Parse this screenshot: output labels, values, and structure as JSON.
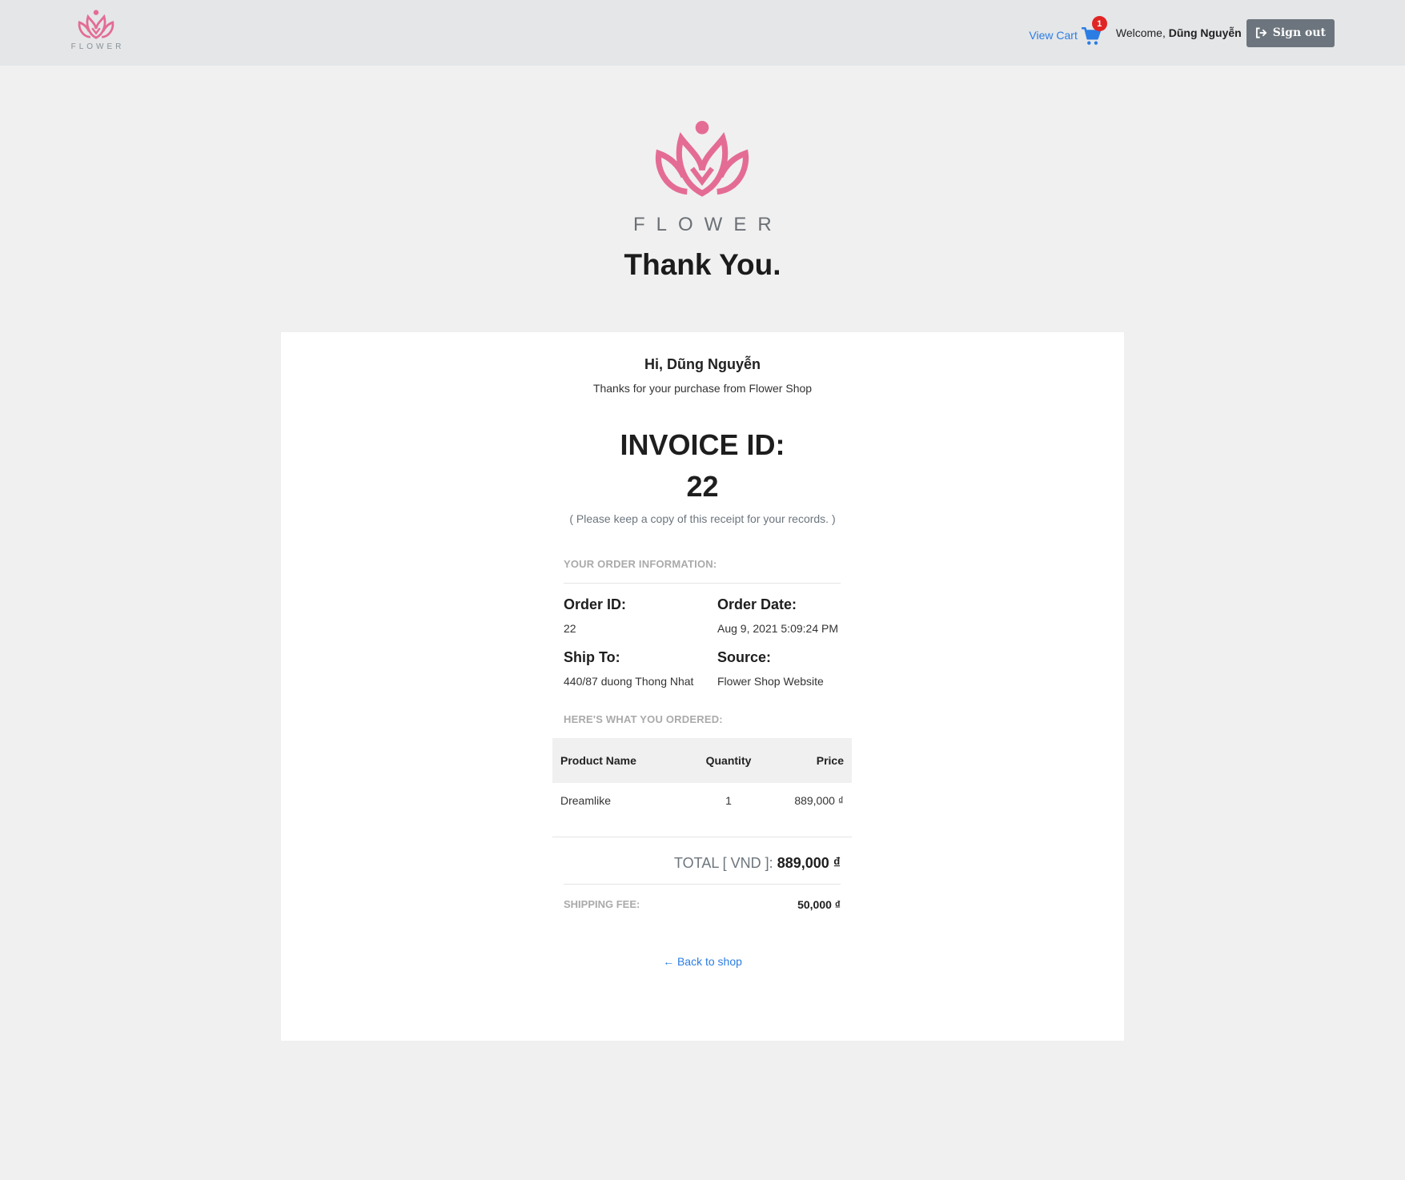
{
  "header": {
    "logo_text": "FLOWER",
    "view_cart_label": "View Cart",
    "cart_count": "1",
    "welcome_prefix": "Welcome, ",
    "user_name": "Dũng Nguyễn",
    "sign_out_label": "Sign out"
  },
  "hero": {
    "logo_text": "FLOWER",
    "heading": "Thank You."
  },
  "receipt": {
    "greeting": "Hi, Dũng Nguyễn",
    "thanks_text": "Thanks for your purchase from Flower Shop",
    "invoice_label": "INVOICE ID:",
    "invoice_id": "22",
    "keep_copy_note": "( Please keep a copy of this receipt for your records. )",
    "order_info_heading": "YOUR ORDER INFORMATION:",
    "order_id_label": "Order ID:",
    "order_id": "22",
    "order_date_label": "Order Date:",
    "order_date": "Aug 9, 2021 5:09:24 PM",
    "ship_to_label": "Ship To:",
    "ship_to": "440/87 duong Thong Nhat",
    "source_label": "Source:",
    "source": "Flower Shop Website",
    "ordered_heading": "HERE'S WHAT YOU ORDERED:",
    "table": {
      "headers": [
        "Product Name",
        "Quantity",
        "Price"
      ],
      "rows": [
        [
          "Dreamlike",
          "1",
          "889,000 ₫"
        ]
      ]
    },
    "total_label": "TOTAL [ VND ]: ",
    "total_value": "889,000 ₫",
    "shipping_fee_label": "SHIPPING FEE:",
    "shipping_fee_value": "50,000 ₫",
    "back_link": "← Back to shop"
  },
  "colors": {
    "brand_pink": "#e46c94",
    "link_blue": "#2b7de3",
    "badge_red": "#e02424",
    "button_gray": "#6c757d"
  },
  "icons": [
    "lotus-logo-icon",
    "shopping-cart-icon",
    "sign-out-icon"
  ]
}
